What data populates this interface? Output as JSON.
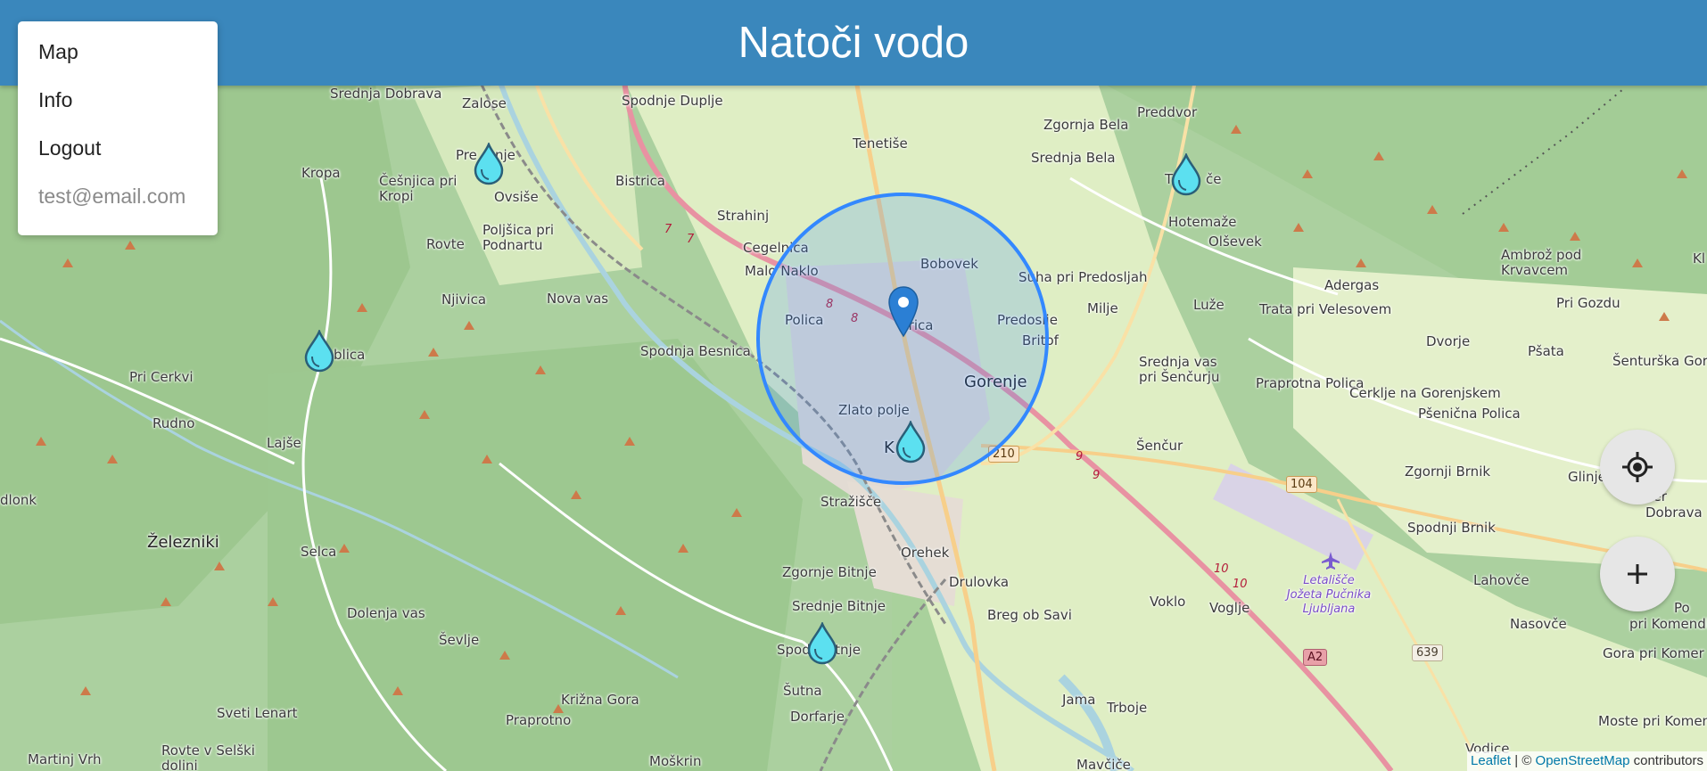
{
  "app": {
    "title": "Natoči vodo"
  },
  "menu": {
    "items": [
      {
        "label": "Map"
      },
      {
        "label": "Info"
      },
      {
        "label": "Logout"
      }
    ],
    "user_email": "test@email.com"
  },
  "map": {
    "places": {
      "srednja_dobrava": "Srednja Dobrava",
      "zaloše": "Zalose",
      "spodnje_duplje": "Spodnje Duplje",
      "tenetise": "Tenetiše",
      "zgornja_bela": "Zgornja Bela",
      "preddvor": "Preddvor",
      "kropa": "Kropa",
      "cesnjica": "Češnjica pri Kropi",
      "preddvor_partial_1": "Pre",
      "preddvor_partial_2": "nje",
      "ovsise": "Ovsiše",
      "bistrica": "Bistrica",
      "srednja_bela": "Srednja Bela",
      "tupalice_partial_1": "T",
      "tupalice_partial_2": "če",
      "strahinj": "Strahinj",
      "hotemaze": "Hotemaže",
      "olsevek": "Olševek",
      "rovte": "Rovte",
      "poljsica": "Poljšica pri Podnartu",
      "cegelnica": "Cegelnica",
      "ambroz": "Ambrož pod Krvavcem",
      "bobovek": "Bobovek",
      "malo_naklo": "Malo Naklo",
      "suha": "Suha pri Predosljah",
      "adergas": "Adergas",
      "njivica": "Njivica",
      "nova_vas": "Nova vas",
      "milje": "Milje",
      "luze": "Luže",
      "trata": "Trata pri Velesovem",
      "pri_gozdu": "Pri Gozdu",
      "polica": "Polica",
      "kokrica_partial": "krica",
      "predoslje": "Predoslje",
      "britof": "Britof",
      "dvorje": "Dvorje",
      "psata": "Pšata",
      "senturska": "Šenturška Gora",
      "podblica_partial": "blica",
      "spodnja_besnica": "Spodnja Besnica",
      "srednja_vas": "Srednja vas pri Šenčurju",
      "praprotna": "Praprotna Polica",
      "cerklje": "Cerklje na Gorenjskem",
      "pri_cerkvi": "Pri Cerkvi",
      "gorenje": "Gorenje",
      "psenicna": "Pšenična Polica",
      "rudno": "Rudno",
      "zlato_polje": "Zlato polje",
      "sencur": "Šenčur",
      "lajse": "Lajše",
      "kranj_partial_1": "K",
      "kranj_partial_2": "j",
      "zgornji_brnik": "Zgornji Brnik",
      "glinje": "Glinje",
      "dlonk": "dlonk",
      "strazisce": "Stražišče",
      "cerklje_partial": "Cer",
      "dobrava": "Dobrava",
      "zelezniki": "Železniki",
      "selca": "Selca",
      "orehek": "Orehek",
      "spodnji_brnik": "Spodnji Brnik",
      "zgornje_bitnje": "Zgornje Bitnje",
      "drulovka": "Drulovka",
      "lahovce": "Lahovče",
      "po_partial": "Po",
      "komendi": "pri Komendi",
      "srednje_bitnje": "Srednje Bitnje",
      "vklo": "Voklo",
      "voglje": "Voglje",
      "dolenja_vas": "Dolenja vas",
      "breg": "Breg ob Savi",
      "nasovce": "Nasovče",
      "sevlje": "Ševlje",
      "spodnje_bitnje_partial_1": "Spod",
      "spodnje_bitnje_partial_2": "itnje",
      "gora_pri": "Gora pri Komer",
      "sutna": "Šutna",
      "dorfarje": "Dorfarje",
      "krizna_gora": "Križna Gora",
      "jama": "Jama",
      "trboje": "Trboje",
      "sveti_lenart": "Sveti Lenart",
      "praprotno": "Praprotno",
      "moste": "Moste pri Komen",
      "martinj_vrh": "Martinj Vrh",
      "rovte_selski": "Rovte v Selški dolini",
      "moskrin": "Moškrin",
      "mavcice": "Mavčiče",
      "vodice": "Vodice",
      "kl": "Kl",
      "airport": "Letališče Jožeta Pučnika Ljubljana"
    },
    "road_labels": {
      "r210": "210",
      "r104": "104",
      "a2": "A2",
      "r639": "639",
      "n7a": "7",
      "n7b": "7",
      "n8a": "8",
      "n8b": "8",
      "n9a": "9",
      "n9b": "9",
      "n10a": "10",
      "n10b": "10"
    },
    "search_radius_circle": true,
    "water_marker_count": 6
  },
  "controls": {
    "locate_icon": "locate-crosshair-icon",
    "zoom_in_icon": "plus-icon"
  },
  "attribution": {
    "leaflet": "Leaflet",
    "separator": "| ©",
    "osm": "OpenStreetMap",
    "contributors": "contributors"
  },
  "colors": {
    "header": "#3a87bc",
    "circle_stroke": "#3388ff",
    "water_drop": "#5ce0f0",
    "pin": "#2b7fd4"
  }
}
